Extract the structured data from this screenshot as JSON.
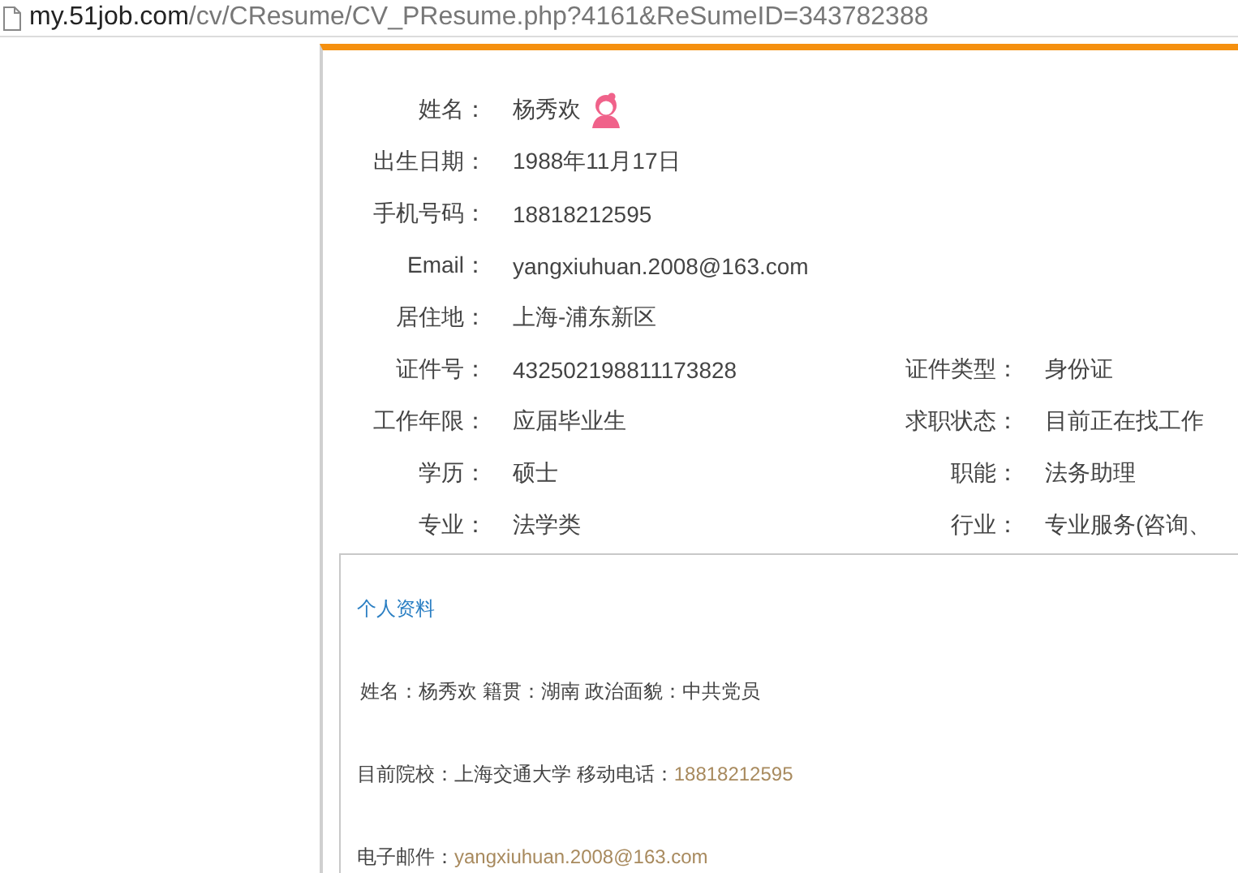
{
  "address_bar": {
    "host": "my.51job.com",
    "path": "/cv/CResume/CV_PResume.php?4161&ReSumeID=343782388"
  },
  "resume": {
    "rows": [
      {
        "label": "姓名：",
        "value": "杨秀欢",
        "badge": true
      },
      {
        "label": "出生日期：",
        "value": "1988年11月17日"
      },
      {
        "label": "手机号码：",
        "value": "18818212595"
      },
      {
        "label": "Email：",
        "value": "yangxiuhuan.2008@163.com"
      },
      {
        "label": "居住地：",
        "value": "上海-浦东新区"
      },
      {
        "label": "证件号：",
        "value": "432502198811173828",
        "label_2": "证件类型：",
        "value_2": "身份证"
      },
      {
        "label": "工作年限：",
        "value": "应届毕业生",
        "label_2": "求职状态：",
        "value_2": "目前正在找工作"
      },
      {
        "label": "学历：",
        "value": "硕士",
        "label_2": "职能：",
        "value_2": "法务助理"
      },
      {
        "label": "专业：",
        "value": "法学类",
        "label_2": "行业：",
        "value_2": "专业服务(咨询、"
      }
    ],
    "profile": {
      "heading": "个人资料",
      "lines": [
        {
          "text": "姓名：杨秀欢 籍贯：湖南 政治面貌：中共党员"
        },
        {
          "text": "目前院校：上海交通大学 移动电话：",
          "value": "18818212595"
        },
        {
          "text": "电子邮件：",
          "value": "yangxiuhuan.2008@163.com"
        }
      ]
    }
  }
}
